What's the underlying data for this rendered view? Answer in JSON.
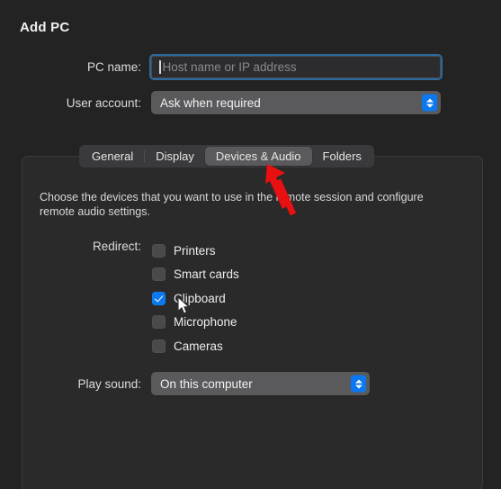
{
  "window": {
    "title": "Add PC"
  },
  "form": {
    "pc_name": {
      "label": "PC name:",
      "value": "",
      "placeholder": "Host name or IP address"
    },
    "user_account": {
      "label": "User account:",
      "value": "Ask when required"
    }
  },
  "tabs": [
    {
      "label": "General",
      "selected": false
    },
    {
      "label": "Display",
      "selected": false
    },
    {
      "label": "Devices & Audio",
      "selected": true
    },
    {
      "label": "Folders",
      "selected": false
    }
  ],
  "panel": {
    "description": "Choose the devices that you want to use in the remote session and configure remote audio settings.",
    "redirect": {
      "label": "Redirect:",
      "items": [
        {
          "label": "Printers",
          "checked": false
        },
        {
          "label": "Smart cards",
          "checked": false
        },
        {
          "label": "Clipboard",
          "checked": true
        },
        {
          "label": "Microphone",
          "checked": false
        },
        {
          "label": "Cameras",
          "checked": false
        }
      ]
    },
    "play_sound": {
      "label": "Play sound:",
      "value": "On this computer"
    }
  },
  "annotations": {
    "arrow_color": "#e81010",
    "arrow_target": "tab-devices-and-audio",
    "cursor_position": "clipboard-checkbox-row"
  },
  "colors": {
    "background": "#232323",
    "panel_background": "#2a2a2a",
    "accent_blue": "#0b78f0",
    "focus_ring": "#2a6a9e",
    "control_gray": "#5a5a5c",
    "tabbar_gray": "#3a3a3c",
    "text_primary": "#ededed",
    "text_placeholder": "#8a8a8d"
  }
}
